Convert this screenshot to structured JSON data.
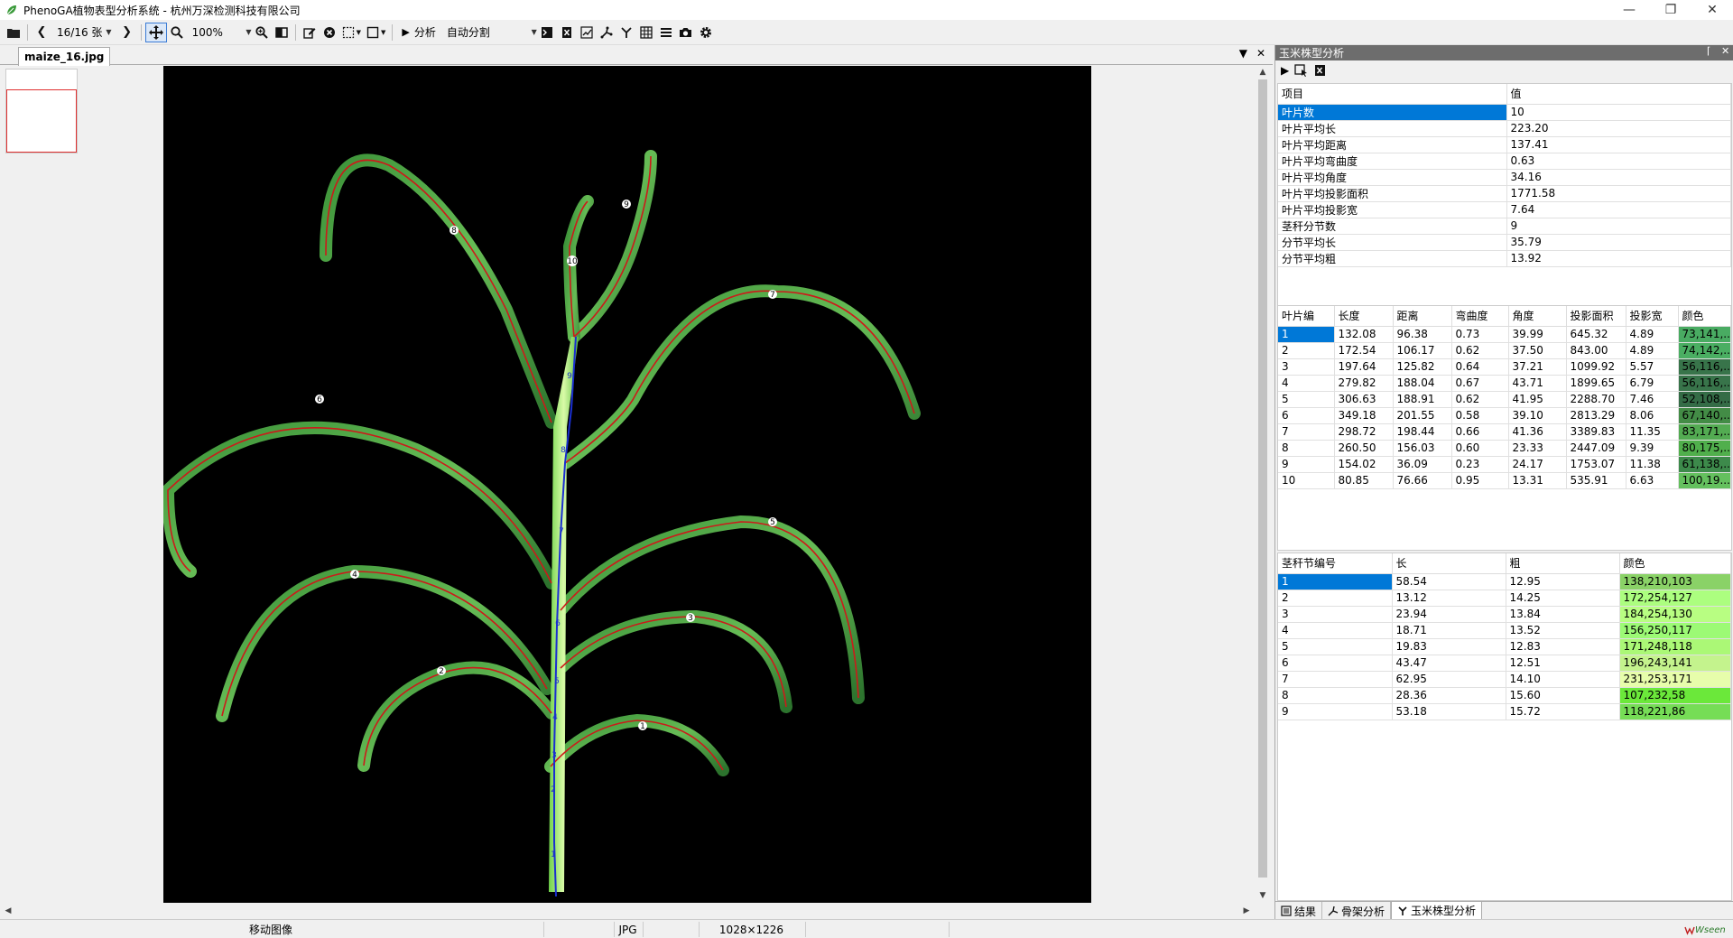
{
  "window": {
    "title": "PhenoGA植物表型分析系统 - 杭州万深检测科技有限公司",
    "controls": [
      "minimize-icon",
      "restore-icon",
      "close-icon"
    ]
  },
  "toolbar": {
    "page_counter": "16/16 张",
    "zoom_value": "100%",
    "analyze_label": "分析",
    "segmentation_mode": "自动分割"
  },
  "document": {
    "tab_label": "maize_16.jpg"
  },
  "right_panel": {
    "title": "玉米株型分析",
    "summary": {
      "headers": [
        "项目",
        "值"
      ],
      "rows": [
        [
          "叶片数",
          "10"
        ],
        [
          "叶片平均长",
          "223.20"
        ],
        [
          "叶片平均距离",
          "137.41"
        ],
        [
          "叶片平均弯曲度",
          "0.63"
        ],
        [
          "叶片平均角度",
          "34.16"
        ],
        [
          "叶片平均投影面积",
          "1771.58"
        ],
        [
          "叶片平均投影宽",
          "7.64"
        ],
        [
          "茎秆分节数",
          "9"
        ],
        [
          "分节平均长",
          "35.79"
        ],
        [
          "分节平均粗",
          "13.92"
        ]
      ]
    },
    "leaves": {
      "headers": [
        "叶片编",
        "长度",
        "距离",
        "弯曲度",
        "角度",
        "投影面积",
        "投影宽",
        "颜色"
      ],
      "rows": [
        [
          "1",
          "132.08",
          "96.38",
          "0.73",
          "39.99",
          "645.32",
          "4.89",
          "73,141,..."
        ],
        [
          "2",
          "172.54",
          "106.17",
          "0.62",
          "37.50",
          "843.00",
          "4.89",
          "74,142,..."
        ],
        [
          "3",
          "197.64",
          "125.82",
          "0.64",
          "37.21",
          "1099.92",
          "5.57",
          "56,116,..."
        ],
        [
          "4",
          "279.82",
          "188.04",
          "0.67",
          "43.71",
          "1899.65",
          "6.79",
          "56,116,..."
        ],
        [
          "5",
          "306.63",
          "188.91",
          "0.62",
          "41.95",
          "2288.70",
          "7.46",
          "52,108,..."
        ],
        [
          "6",
          "349.18",
          "201.55",
          "0.58",
          "39.10",
          "2813.29",
          "8.06",
          "67,140,..."
        ],
        [
          "7",
          "298.72",
          "198.44",
          "0.66",
          "41.36",
          "3389.83",
          "11.35",
          "83,171,..."
        ],
        [
          "8",
          "260.50",
          "156.03",
          "0.60",
          "23.33",
          "2447.09",
          "9.39",
          "80,175,..."
        ],
        [
          "9",
          "154.02",
          "36.09",
          "0.23",
          "24.17",
          "1753.07",
          "11.38",
          "61,138,..."
        ],
        [
          "10",
          "80.85",
          "76.66",
          "0.95",
          "13.31",
          "535.91",
          "6.63",
          "100,19..."
        ]
      ],
      "swatches": [
        "#49ab62",
        "#4aae62",
        "#38744a",
        "#38744a",
        "#346c46",
        "#438c46",
        "#53ab52",
        "#50af4c",
        "#3d8a4b",
        "#64c05e"
      ]
    },
    "stems": {
      "headers": [
        "茎秆节编号",
        "长",
        "粗",
        "颜色"
      ],
      "rows": [
        [
          "1",
          "58.54",
          "12.95",
          "138,210,103"
        ],
        [
          "2",
          "13.12",
          "14.25",
          "172,254,127"
        ],
        [
          "3",
          "23.94",
          "13.84",
          "184,254,130"
        ],
        [
          "4",
          "18.71",
          "13.52",
          "156,250,117"
        ],
        [
          "5",
          "19.83",
          "12.83",
          "171,248,118"
        ],
        [
          "6",
          "43.47",
          "12.51",
          "196,243,141"
        ],
        [
          "7",
          "62.95",
          "14.10",
          "231,253,171"
        ],
        [
          "8",
          "28.36",
          "15.60",
          "107,232,58"
        ],
        [
          "9",
          "53.18",
          "15.72",
          "118,221,86"
        ]
      ],
      "swatches": [
        "#8ad267",
        "#acfe7f",
        "#b8fe82",
        "#9cfa75",
        "#abf876",
        "#c4f38d",
        "#e7fdab",
        "#6be83a",
        "#76dd56"
      ]
    },
    "bottom_tabs": [
      "结果",
      "骨架分析",
      "玉米株型分析"
    ]
  },
  "statusbar": {
    "mode": "移动图像",
    "format": "JPG",
    "dimensions": "1028×1226"
  },
  "logo_text": "Wseen"
}
